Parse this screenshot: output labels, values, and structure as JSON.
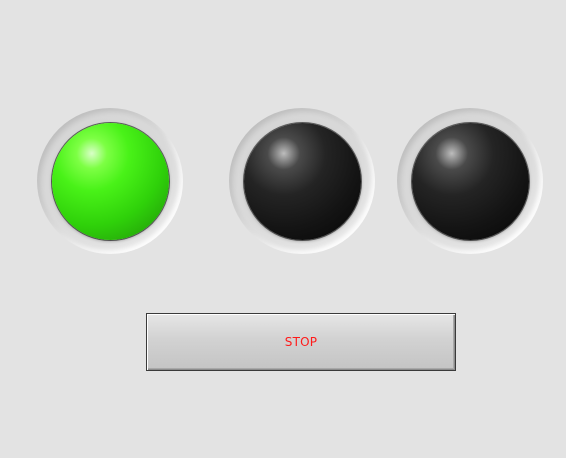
{
  "indicators": [
    {
      "name": "indicator-1",
      "state": "on",
      "color": "#49f218"
    },
    {
      "name": "indicator-2",
      "state": "off",
      "color": "#1a1a1a"
    },
    {
      "name": "indicator-3",
      "state": "off",
      "color": "#111111"
    }
  ],
  "stop_button": {
    "label": "STOP",
    "text_color": "#ff1a1a"
  }
}
